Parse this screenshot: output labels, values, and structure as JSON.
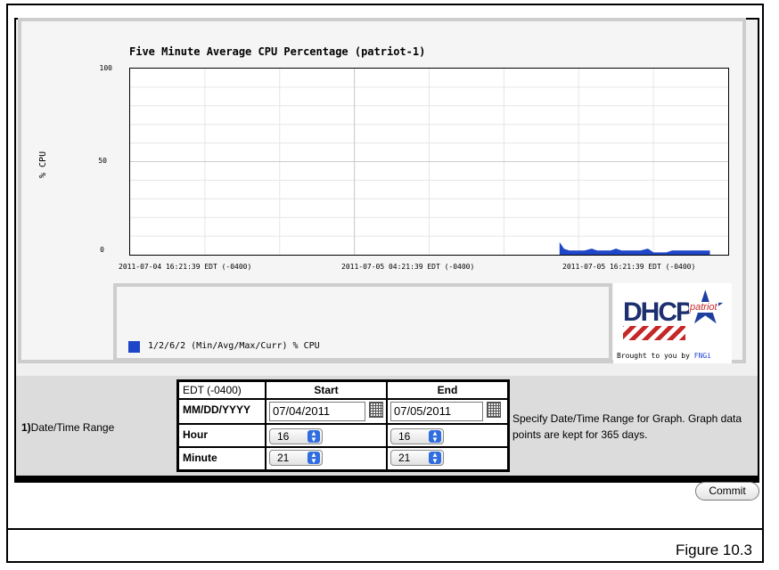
{
  "graph": {
    "title": "Five Minute Average CPU Percentage (patriot-1)",
    "y_axis_label": "% CPU",
    "legend_text": "1/2/6/2 (Min/Avg/Max/Curr) % CPU",
    "brought_by_prefix": "Brought to you by ",
    "brought_by_link": "FNGi",
    "logo_text": "DHCP",
    "logo_sub": "patriot"
  },
  "colors": {
    "series": "#1f46c7",
    "grid": "#cccccc",
    "background_panel": "#dcdcdc"
  },
  "chart_data": {
    "type": "area",
    "title": "Five Minute Average CPU Percentage (patriot-1)",
    "ylabel": "% CPU",
    "ylim": [
      0,
      100
    ],
    "yticks": [
      "100",
      "50",
      "0"
    ],
    "xticks": [
      "2011-07-04 16:21:39 EDT (-0400)",
      "2011-07-05 04:21:39 EDT (-0400)",
      "2011-07-05 16:21:39 EDT (-0400)"
    ],
    "legend": "1/2/6/2 (Min/Avg/Max/Curr) % CPU",
    "grid": true,
    "series": [
      {
        "name": "% CPU",
        "x_hours": [
          23.0,
          23.2,
          23.5,
          24.0,
          24.3,
          24.7,
          25.0,
          25.3,
          25.7,
          26.0,
          26.3,
          26.7,
          27.0,
          27.3,
          27.7,
          28.0,
          28.3,
          28.7,
          29.0,
          29.3,
          29.7,
          30.0,
          30.3,
          30.7,
          31.0
        ],
        "values": [
          6,
          3,
          2,
          2,
          2,
          3,
          2,
          2,
          2,
          3,
          2,
          2,
          2,
          2,
          3,
          1,
          1,
          1,
          2,
          2,
          2,
          2,
          2,
          2,
          2
        ]
      }
    ]
  },
  "form": {
    "row_number": "1)",
    "row_label": "Date/Time Range",
    "timezone": "EDT (-0400)",
    "start_header": "Start",
    "end_header": "End",
    "date_label": "MM/DD/YYYY",
    "hour_label": "Hour",
    "minute_label": "Minute",
    "start_date": "07/04/2011",
    "end_date": "07/05/2011",
    "start_hour": "16",
    "end_hour": "16",
    "start_minute": "21",
    "end_minute": "21",
    "help_text": "Specify Date/Time Range for Graph. Graph data points are kept for 365 days."
  },
  "commit_label": "Commit",
  "figure_caption": "Figure 10.3"
}
